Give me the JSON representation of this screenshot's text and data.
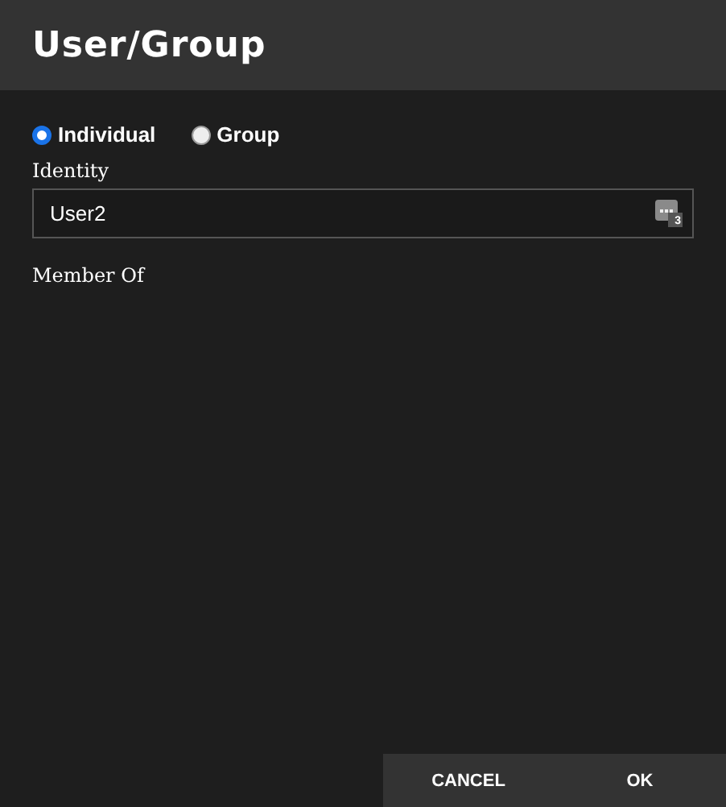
{
  "window": {
    "title": "User/Group"
  },
  "radios": [
    {
      "label": "Individual",
      "selected": true
    },
    {
      "label": "Group",
      "selected": false
    }
  ],
  "identity": {
    "label": "Identity",
    "value": "User2",
    "picker_badge": "3"
  },
  "member_of": {
    "label": "Member Of"
  },
  "buttons": [
    "CANCEL",
    "OK"
  ]
}
